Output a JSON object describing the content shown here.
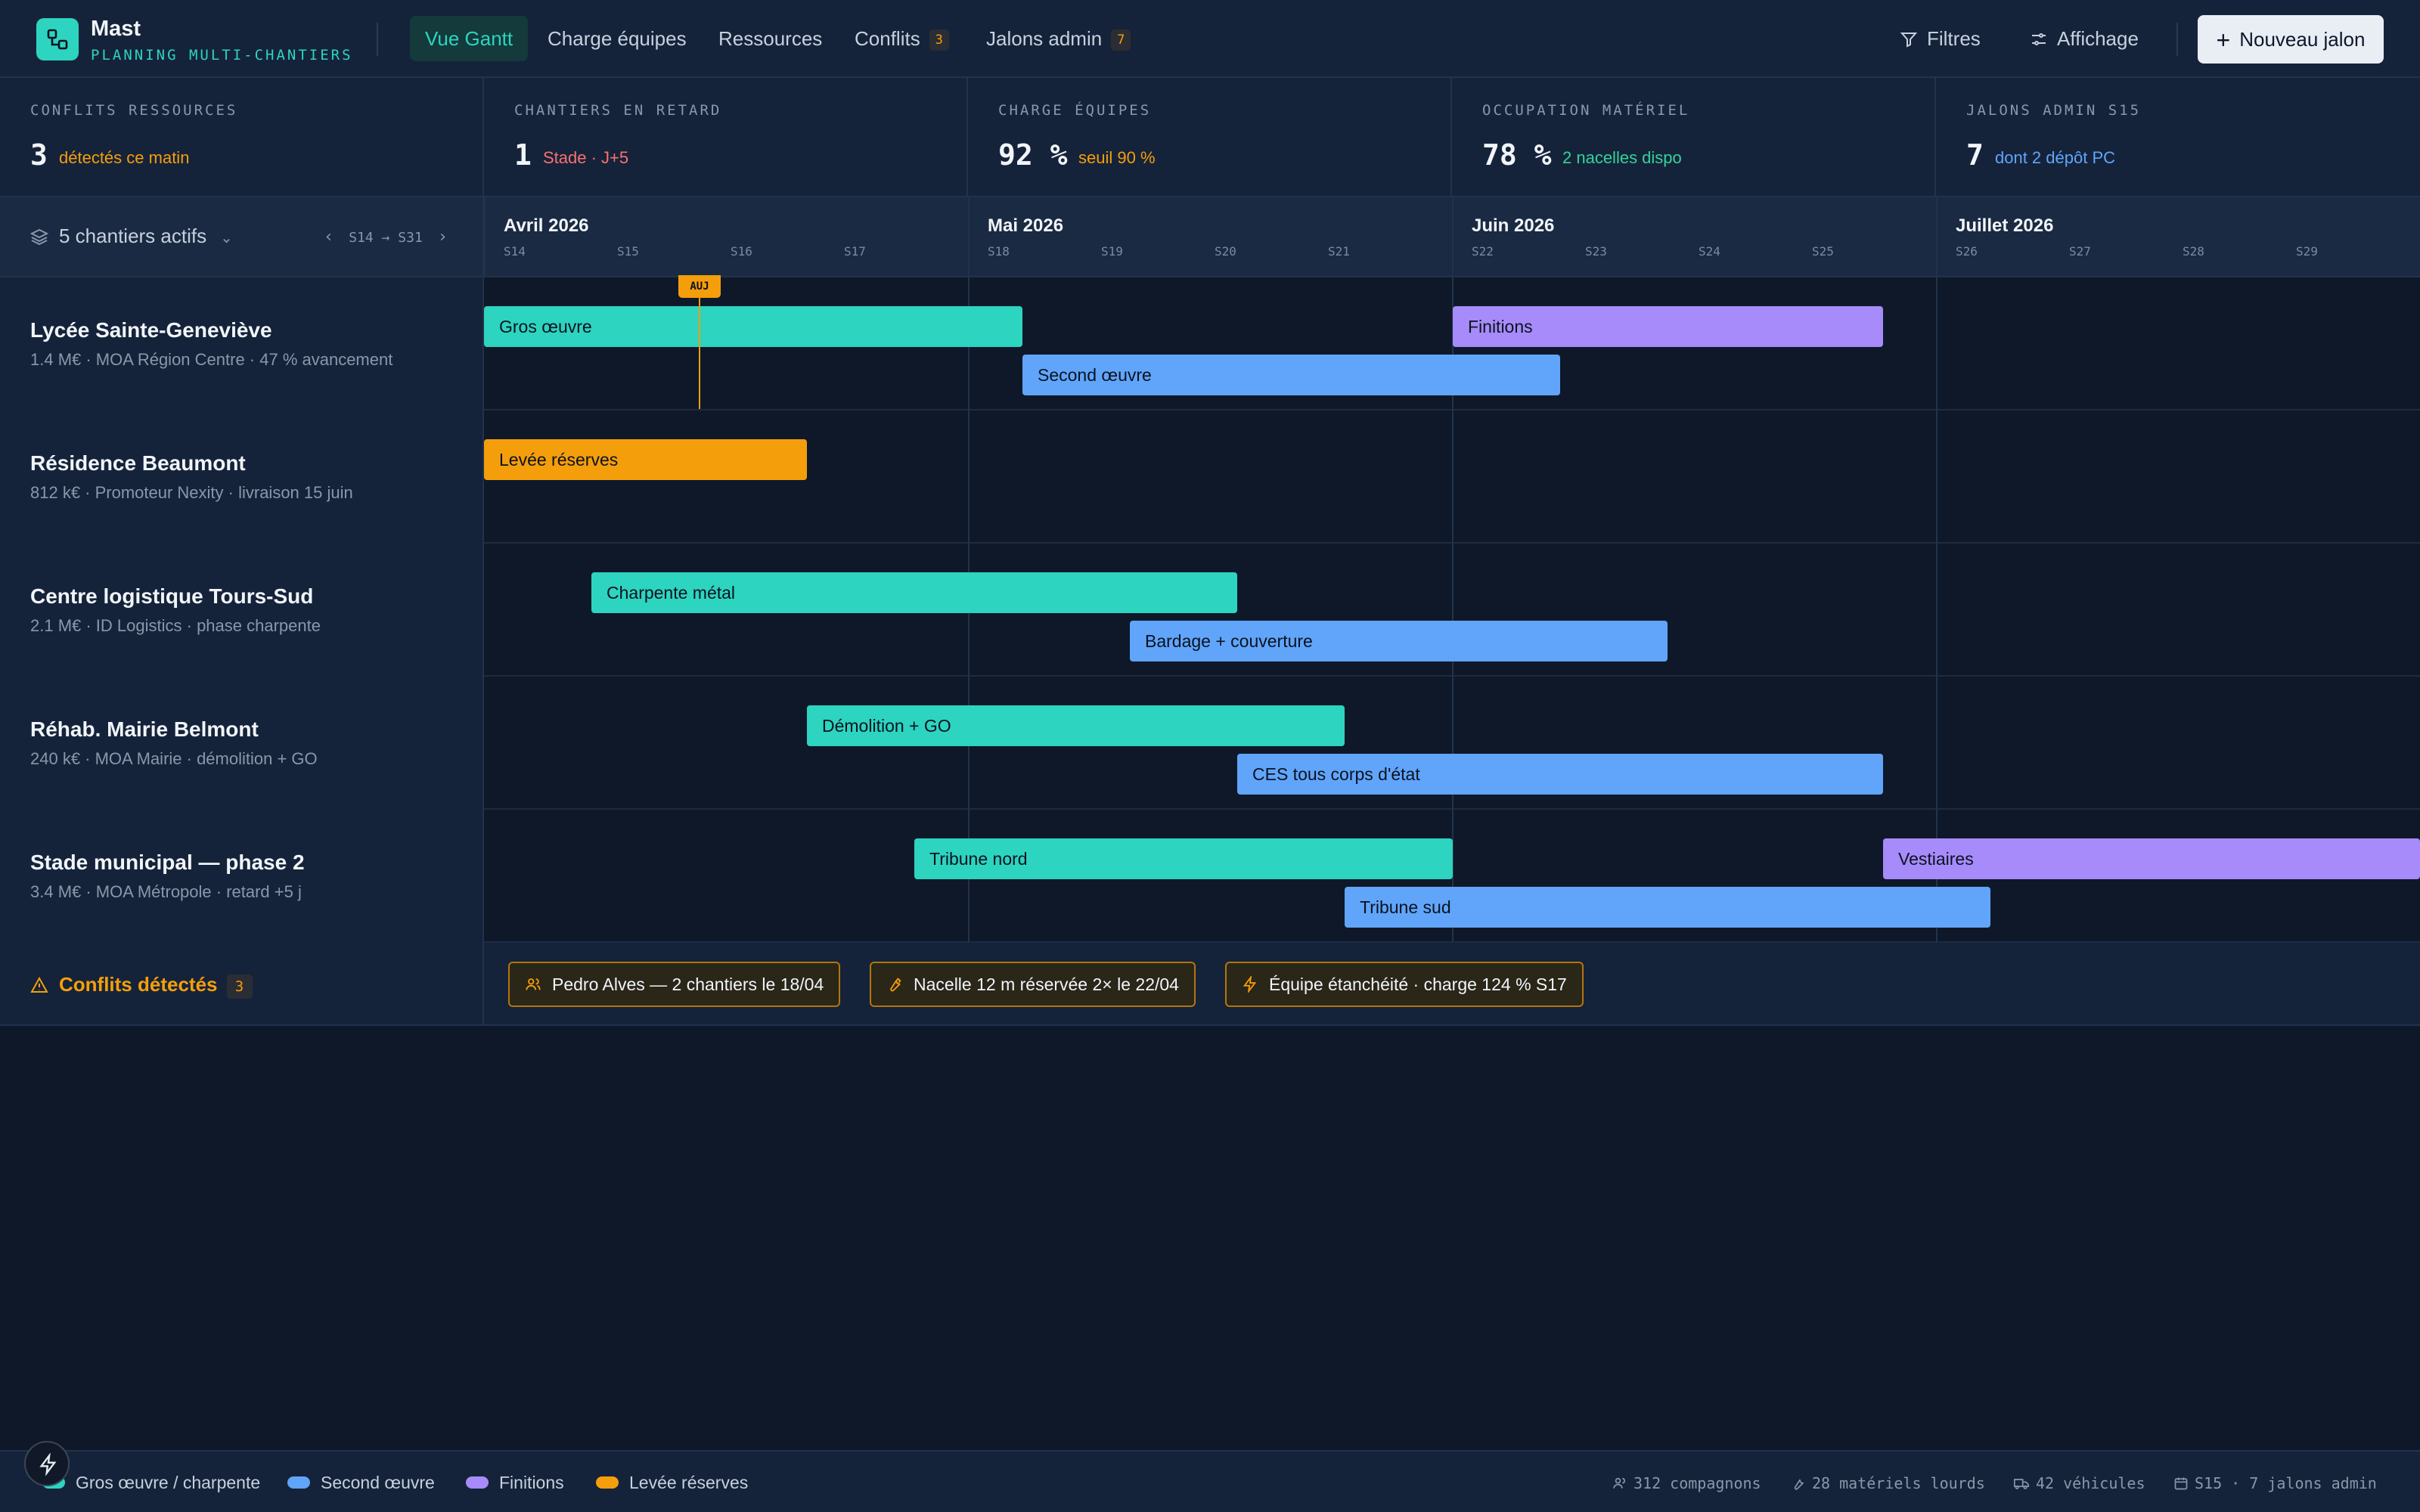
{
  "app": {
    "name": "Mast",
    "subtitle": "PLANNING MULTI-CHANTIERS"
  },
  "nav": {
    "tabs": [
      {
        "label": "Vue Gantt",
        "active": true
      },
      {
        "label": "Charge équipes"
      },
      {
        "label": "Ressources"
      },
      {
        "label": "Conflits",
        "badge": "3"
      },
      {
        "label": "Jalons admin",
        "badge": "7"
      }
    ]
  },
  "toolbar": {
    "filters_label": "Filtres",
    "display_label": "Affichage",
    "new_milestone_label": "Nouveau jalon"
  },
  "kpis": [
    {
      "label": "CONFLITS RESSOURCES",
      "value": "3",
      "note": "détectés ce matin",
      "note_color": "#f59e0b"
    },
    {
      "label": "CHANTIERS EN RETARD",
      "value": "1",
      "note": "Stade · J+5",
      "note_color": "#f87171"
    },
    {
      "label": "CHARGE ÉQUIPES",
      "value": "92 %",
      "note": "seuil 90 %",
      "note_color": "#f59e0b"
    },
    {
      "label": "OCCUPATION MATÉRIEL",
      "value": "78 %",
      "note": "2 nacelles dispo",
      "note_color": "#34d399"
    },
    {
      "label": "JALONS ADMIN S15",
      "value": "7",
      "note": "dont 2 dépôt PC",
      "note_color": "#60a5fa"
    }
  ],
  "timeline": {
    "projects_count_label": "5 chantiers actifs",
    "week_range": "S14 → S31",
    "today_label": "AUJ",
    "months": [
      {
        "name": "Avril 2026",
        "weeks": [
          "S14",
          "S15",
          "S16",
          "S17"
        ]
      },
      {
        "name": "Mai 2026",
        "weeks": [
          "S18",
          "S19",
          "S20",
          "S21"
        ]
      },
      {
        "name": "Juin 2026",
        "weeks": [
          "S22",
          "S23",
          "S24",
          "S25"
        ]
      },
      {
        "name": "Juillet 2026",
        "weeks": [
          "S26",
          "S27",
          "S28",
          "S29"
        ]
      }
    ]
  },
  "projects": [
    {
      "name": "Lycée Sainte-Geneviève",
      "meta": "1.4 M€ · MOA Région Centre · 47 % avancement",
      "bars": [
        {
          "label": "Gros œuvre",
          "kind": "go",
          "start": 0,
          "end": 5,
          "lane": 0
        },
        {
          "label": "Second œuvre",
          "kind": "so",
          "start": 5,
          "end": 10,
          "lane": 1
        },
        {
          "label": "Finitions",
          "kind": "fi",
          "start": 9,
          "end": 13,
          "lane": 0
        }
      ]
    },
    {
      "name": "Résidence Beaumont",
      "meta": "812 k€ · Promoteur Nexity · livraison 15 juin",
      "bars": [
        {
          "label": "Levée réserves",
          "kind": "lr",
          "start": 0,
          "end": 3,
          "lane": 0
        }
      ]
    },
    {
      "name": "Centre logistique Tours-Sud",
      "meta": "2.1 M€ · ID Logistics · phase charpente",
      "bars": [
        {
          "label": "Charpente métal",
          "kind": "go",
          "start": 1,
          "end": 7,
          "lane": 0
        },
        {
          "label": "Bardage + couverture",
          "kind": "so",
          "start": 6,
          "end": 11,
          "lane": 1
        }
      ]
    },
    {
      "name": "Réhab. Mairie Belmont",
      "meta": "240 k€ · MOA Mairie · démolition + GO",
      "bars": [
        {
          "label": "Démolition + GO",
          "kind": "go",
          "start": 3,
          "end": 8,
          "lane": 0
        },
        {
          "label": "CES tous corps d'état",
          "kind": "so",
          "start": 7,
          "end": 13,
          "lane": 1
        }
      ]
    },
    {
      "name": "Stade municipal — phase 2",
      "meta": "3.4 M€ · MOA Métropole · retard +5 j",
      "bars": [
        {
          "label": "Tribune nord",
          "kind": "go",
          "start": 4,
          "end": 9,
          "lane": 0
        },
        {
          "label": "Tribune sud",
          "kind": "so",
          "start": 8,
          "end": 14,
          "lane": 1
        },
        {
          "label": "Vestiaires",
          "kind": "fi",
          "start": 13,
          "end": 18,
          "lane": 0
        }
      ]
    }
  ],
  "conflicts": {
    "title": "Conflits détectés",
    "count": "3",
    "items": [
      {
        "label": "Pedro Alves — 2 chantiers le 18/04",
        "icon": "users-icon"
      },
      {
        "label": "Nacelle 12 m réservée 2× le 22/04",
        "icon": "wrench-icon"
      },
      {
        "label": "Équipe étanchéité · charge 124 % S17",
        "icon": "bolt-icon"
      }
    ]
  },
  "legend": [
    {
      "label": "Gros œuvre / charpente",
      "color": "#2dd4bf"
    },
    {
      "label": "Second œuvre",
      "color": "#60a5fa"
    },
    {
      "label": "Finitions",
      "color": "#a78bfa"
    },
    {
      "label": "Levée réserves",
      "color": "#f59e0b"
    }
  ],
  "stats": {
    "workers": "312 compagnons",
    "equipment": "28 matériels lourds",
    "vehicles": "42 véhicules",
    "milestones": "S15 · 7 jalons admin"
  }
}
